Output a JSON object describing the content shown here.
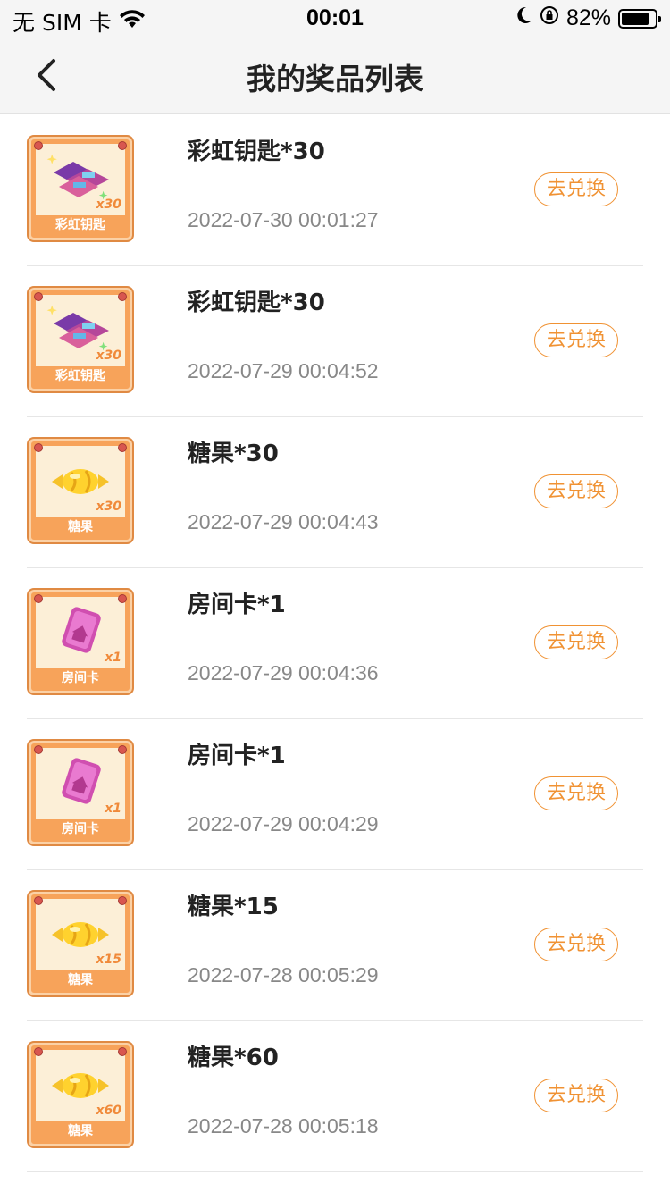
{
  "status_bar": {
    "carrier": "无 SIM 卡",
    "time": "00:01",
    "battery_percent_text": "82%",
    "battery_level": 0.82,
    "icons": [
      "wifi-icon",
      "moon-icon",
      "rotation-lock-icon",
      "battery-icon"
    ]
  },
  "nav": {
    "title": "我的奖品列表",
    "back_icon": "chevron-left-icon"
  },
  "redeem_label": "去兑换",
  "items": [
    {
      "name": "彩虹钥匙*30",
      "time": "2022-07-30 00:01:27",
      "thumb_label": "彩虹钥匙",
      "thumb_qty": "x30",
      "icon": "rainbow-key-icon"
    },
    {
      "name": "彩虹钥匙*30",
      "time": "2022-07-29 00:04:52",
      "thumb_label": "彩虹钥匙",
      "thumb_qty": "x30",
      "icon": "rainbow-key-icon"
    },
    {
      "name": "糖果*30",
      "time": "2022-07-29 00:04:43",
      "thumb_label": "糖果",
      "thumb_qty": "x30",
      "icon": "candy-icon"
    },
    {
      "name": "房间卡*1",
      "time": "2022-07-29 00:04:36",
      "thumb_label": "房间卡",
      "thumb_qty": "x1",
      "icon": "room-card-icon"
    },
    {
      "name": "房间卡*1",
      "time": "2022-07-29 00:04:29",
      "thumb_label": "房间卡",
      "thumb_qty": "x1",
      "icon": "room-card-icon"
    },
    {
      "name": "糖果*15",
      "time": "2022-07-28 00:05:29",
      "thumb_label": "糖果",
      "thumb_qty": "x15",
      "icon": "candy-icon"
    },
    {
      "name": "糖果*60",
      "time": "2022-07-28 00:05:18",
      "thumb_label": "糖果",
      "thumb_qty": "x60",
      "icon": "candy-icon"
    }
  ],
  "colors": {
    "accent": "#f09233",
    "thumb_bg": "#f7a35a"
  }
}
